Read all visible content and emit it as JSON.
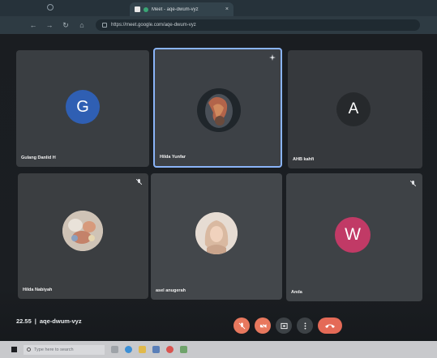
{
  "browser": {
    "tab_title": "Meet - aqe-dwum-vyz",
    "url": "https://meet.google.com/aqe-dwum-vyz"
  },
  "participants": [
    {
      "name": "Gulang Danlid H",
      "avatar_letter": "G",
      "avatar_color": "#2f5fb3"
    },
    {
      "name": "Hilda Yunfar",
      "avatar_letter": "",
      "avatar_color": "#2c3034"
    },
    {
      "name": "AHB kahfi",
      "avatar_letter": "A",
      "avatar_color": "#26292c"
    },
    {
      "name": "Hilda Nabiyah",
      "avatar_letter": "",
      "avatar_color": "#c7b3a3"
    },
    {
      "name": "asel anugerah",
      "avatar_letter": "",
      "avatar_color": "#d5c2b8"
    },
    {
      "name": "Anda",
      "avatar_letter": "W",
      "avatar_color": "#c13a66"
    }
  ],
  "meeting": {
    "time": "22.55",
    "separator": "|",
    "code": "aqe-dwum-vyz"
  },
  "taskbar": {
    "search_placeholder": "Type here to search"
  },
  "colors": {
    "active_speaker_border": "#8ab4f8",
    "end_call": "#e46a57",
    "muted_button": "#e8785e"
  }
}
